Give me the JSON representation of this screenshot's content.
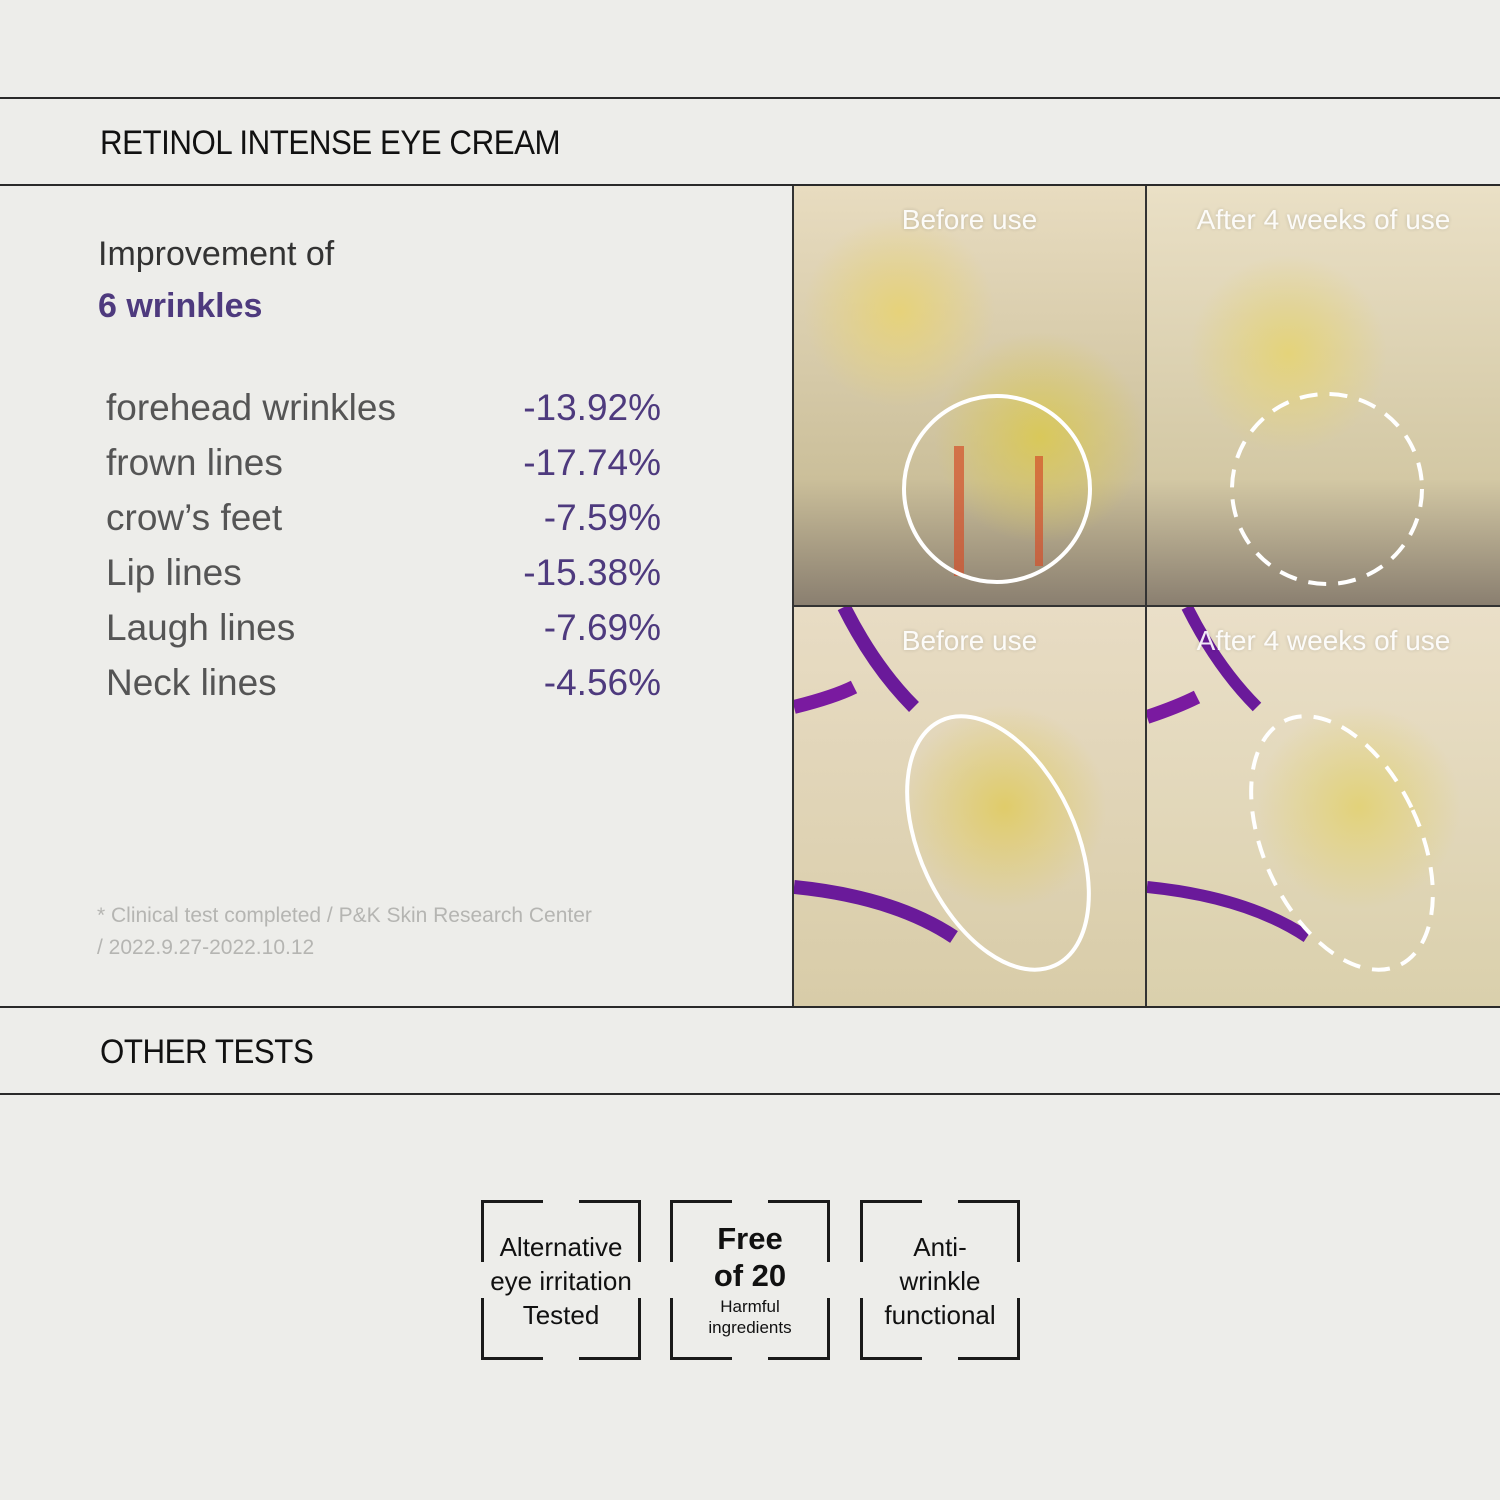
{
  "header": {
    "title": "RETINOL INTENSE EYE CREAM"
  },
  "intro": {
    "line1": "Improvement of",
    "line2": "6 wrinkles"
  },
  "results": [
    {
      "label": "forehead wrinkles",
      "value": "-13.92%"
    },
    {
      "label": "frown lines",
      "value": "-17.74%"
    },
    {
      "label": "crow’s feet",
      "value": "-7.59%"
    },
    {
      "label": "Lip lines",
      "value": "-15.38%"
    },
    {
      "label": "Laugh lines",
      "value": "-7.69%"
    },
    {
      "label": "Neck lines",
      "value": "-4.56%"
    }
  ],
  "note": {
    "line1": "* Clinical test completed / P&K Skin Research Center",
    "line2": "/ 2022.9.27-2022.10.12"
  },
  "photos": [
    {
      "caption": "Before use"
    },
    {
      "caption": "After 4 weeks of use"
    },
    {
      "caption": "Before use"
    },
    {
      "caption": "After 4 weeks of use"
    }
  ],
  "other_tests": {
    "title": "OTHER TESTS",
    "badges": [
      {
        "lines": [
          "Alternative",
          "eye irritation",
          "Tested"
        ]
      },
      {
        "big": [
          "Free",
          "of 20"
        ],
        "small": [
          "Harmful",
          "ingredients"
        ]
      },
      {
        "lines": [
          "Anti-",
          "wrinkle",
          "functional"
        ]
      }
    ]
  },
  "colors": {
    "accent": "#4e3a7e"
  }
}
